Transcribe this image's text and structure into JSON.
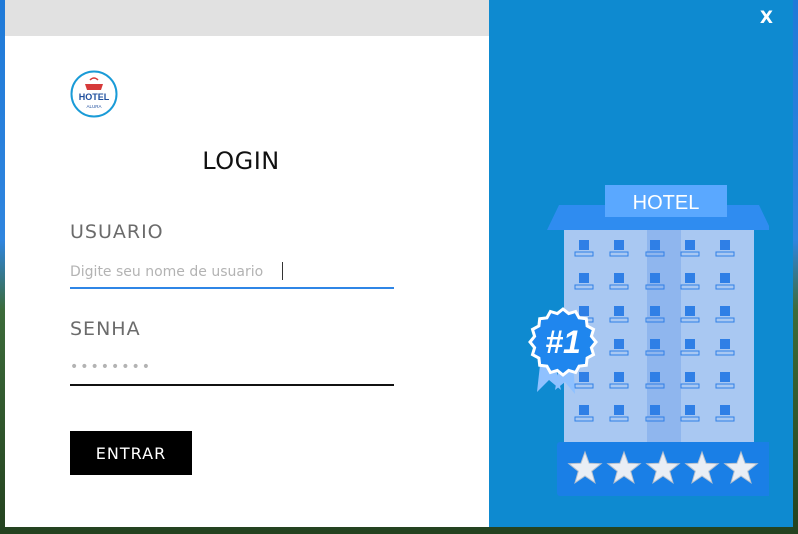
{
  "window": {
    "close_label": "X"
  },
  "logo": {
    "text": "HOTEL",
    "subtext": "ALURA"
  },
  "login": {
    "title": "LOGIN",
    "username_label": "USUARIO",
    "username_placeholder": "Digite seu nome de usuario",
    "username_value": "",
    "password_label": "SENHA",
    "password_value": "••••••••",
    "submit_label": "ENTRAR"
  },
  "illustration": {
    "sign_text": "HOTEL",
    "badge_text": "#1",
    "stars": 5
  },
  "colors": {
    "accent_blue": "#0e8ad0",
    "input_focus": "#2f86e6",
    "button_bg": "#000000"
  }
}
